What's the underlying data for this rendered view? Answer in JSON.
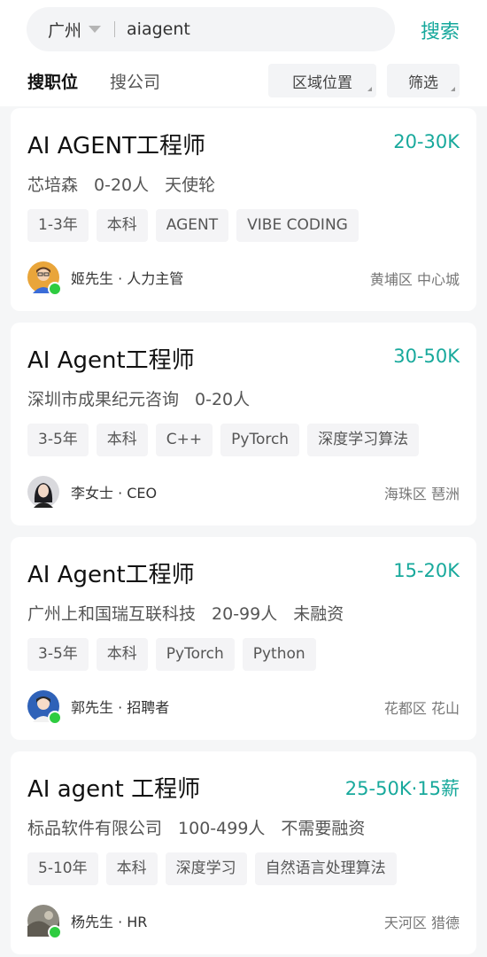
{
  "search": {
    "city": "广州",
    "query": "aiagent",
    "button_label": "搜索"
  },
  "tabs": {
    "active": "搜职位",
    "inactive": "搜公司"
  },
  "filters": {
    "area": "区域位置",
    "filter": "筛选"
  },
  "colors": {
    "accent": "#18a99c",
    "online": "#2ecc40"
  },
  "jobs": [
    {
      "title": "AI AGENT工程师",
      "salary": "20-30K",
      "company": "芯培森",
      "size": "0-20人",
      "stage": "天使轮",
      "tags": [
        "1-3年",
        "本科",
        "AGENT",
        "VIBE CODING"
      ],
      "recruiter": "姬先生 · 人力主管",
      "location": "黄埔区 中心城"
    },
    {
      "title": "AI Agent工程师",
      "salary": "30-50K",
      "company": "深圳市成果纪元咨询",
      "size": "0-20人",
      "stage": "",
      "tags": [
        "3-5年",
        "本科",
        "C++",
        "PyTorch",
        "深度学习算法"
      ],
      "recruiter": "李女士 · CEO",
      "location": "海珠区 琶洲"
    },
    {
      "title": "AI Agent工程师",
      "salary": "15-20K",
      "company": "广州上和国瑞互联科技",
      "size": "20-99人",
      "stage": "未融资",
      "tags": [
        "3-5年",
        "本科",
        "PyTorch",
        "Python"
      ],
      "recruiter": "郭先生 · 招聘者",
      "location": "花都区 花山"
    },
    {
      "title": "AI agent 工程师",
      "salary": "25-50K·15薪",
      "company": "标品软件有限公司",
      "size": "100-499人",
      "stage": "不需要融资",
      "tags": [
        "5-10年",
        "本科",
        "深度学习",
        "自然语言处理算法"
      ],
      "recruiter": "杨先生 · HR",
      "location": "天河区 猎德"
    }
  ]
}
